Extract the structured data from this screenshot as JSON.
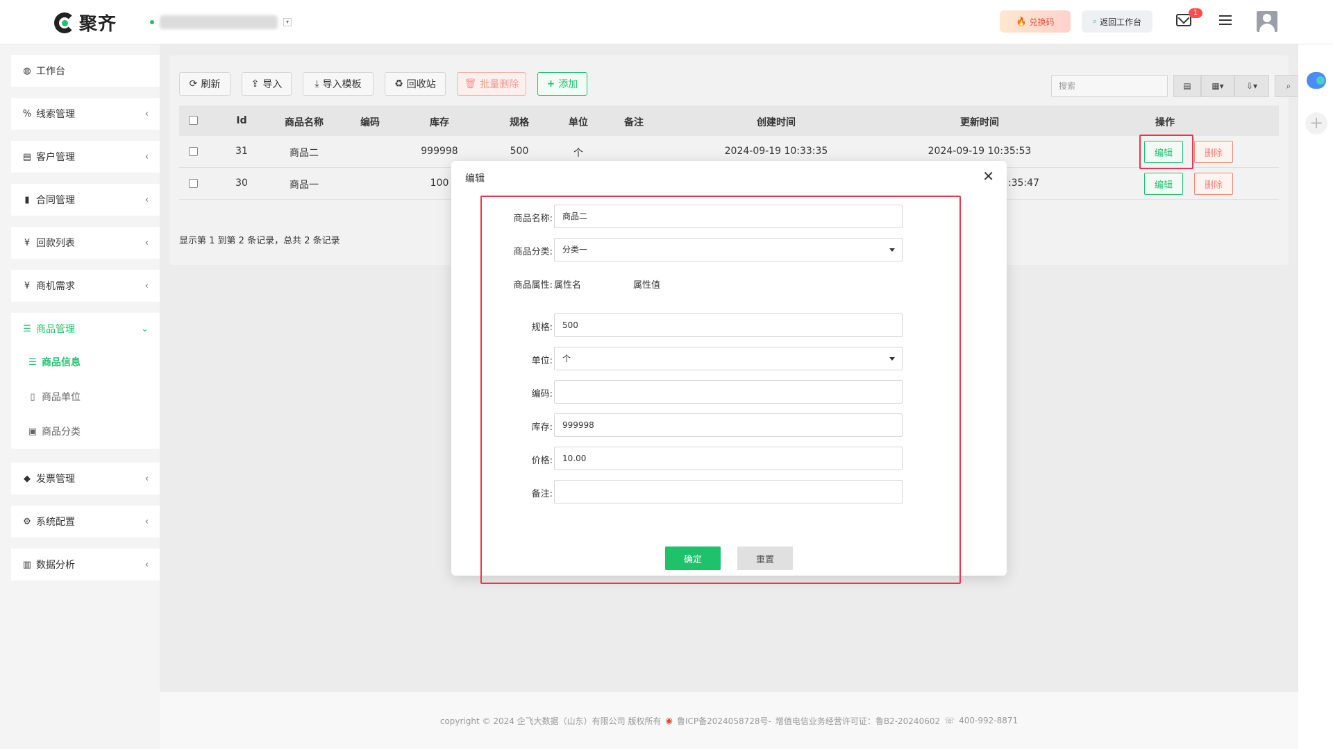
{
  "header": {
    "brand": "聚齐",
    "redeem_label": "兑换码",
    "back_label": "返回工作台",
    "mail_badge": "1"
  },
  "sidebar": {
    "items": [
      {
        "icon": "dashboard-icon",
        "label": "工作台"
      },
      {
        "icon": "link-icon",
        "label": "线索管理"
      },
      {
        "icon": "id-card-icon",
        "label": "客户管理"
      },
      {
        "icon": "bookmark-icon",
        "label": "合同管理"
      },
      {
        "icon": "yen-icon",
        "label": "回款列表"
      },
      {
        "icon": "yen-icon",
        "label": "商机需求"
      },
      {
        "icon": "list-icon",
        "label": "商品管理"
      },
      {
        "icon": "tag-icon",
        "label": "发票管理"
      },
      {
        "icon": "gears-icon",
        "label": "系统配置"
      },
      {
        "icon": "bar-chart-icon",
        "label": "数据分析"
      }
    ],
    "sub_items": [
      {
        "label": "商品信息"
      },
      {
        "label": "商品单位"
      },
      {
        "label": "商品分类"
      }
    ]
  },
  "toolbar": {
    "refresh": "刷新",
    "import": "导入",
    "import_template": "导入模板",
    "recycle": "回收站",
    "batch_delete": "批量删除",
    "add": "添加",
    "search_placeholder": "搜索"
  },
  "table": {
    "columns": [
      "Id",
      "商品名称",
      "编码",
      "库存",
      "规格",
      "单位",
      "备注",
      "创建时间",
      "更新时间",
      "操作"
    ],
    "rows": [
      {
        "id": "31",
        "name": "商品二",
        "code": "",
        "stock": "999998",
        "spec": "500",
        "unit": "个",
        "note": "",
        "created": "2024-09-19 10:33:35",
        "updated": "2024-09-19 10:35:53"
      },
      {
        "id": "30",
        "name": "商品一",
        "code": "",
        "stock": "100",
        "spec": "",
        "unit": "",
        "note": "",
        "created": "",
        "updated": ":35:47"
      }
    ],
    "edit_label": "编辑",
    "delete_label": "删除",
    "summary": "显示第 1 到第 2 条记录，总共 2 条记录"
  },
  "modal": {
    "title": "编辑",
    "fields": {
      "name_label": "商品名称:",
      "name_value": "商品二",
      "category_label": "商品分类:",
      "category_value": "分类一",
      "attr_label": "商品属性:",
      "attr_name_header": "属性名",
      "attr_value_header": "属性值",
      "spec_label": "规格:",
      "spec_value": "500",
      "unit_label": "单位:",
      "unit_value": "个",
      "code_label": "编码:",
      "code_value": "",
      "stock_label": "库存:",
      "stock_value": "999998",
      "price_label": "价格:",
      "price_value": "10.00",
      "note_label": "备注:",
      "note_value": ""
    },
    "confirm_label": "确定",
    "reset_label": "重置"
  },
  "footer": {
    "copyright": "copyright © 2024 企飞大数据（山东）有限公司 版权所有",
    "icp": "鲁ICP备2024058728号-",
    "license": "增值电信业务经营许可证：鲁B2-20240602",
    "phone": "400-992-8871"
  },
  "colors": {
    "accent": "#1ec26b",
    "danger": "#f08877",
    "highlight": "#e8364f"
  }
}
